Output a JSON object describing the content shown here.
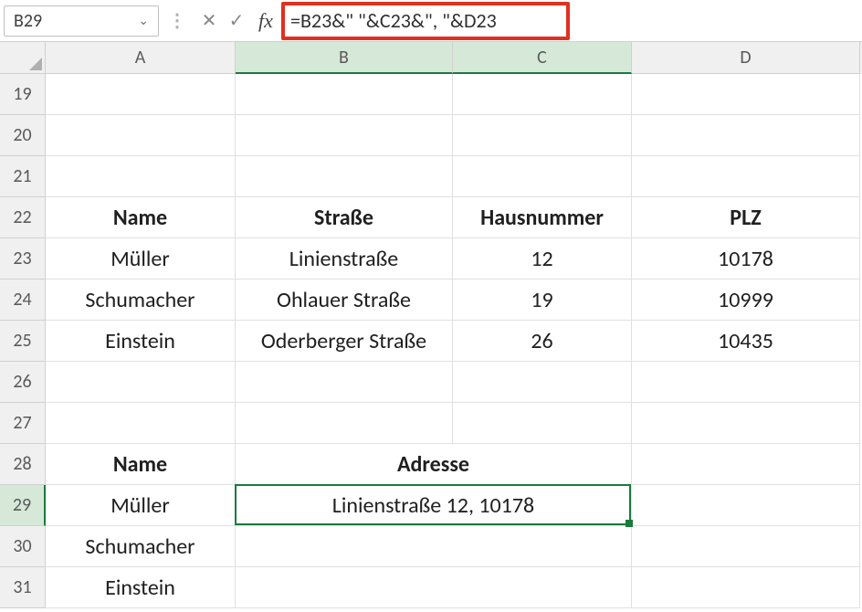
{
  "name_box": "B29",
  "formula": "=B23&\" \"&C23&\", \"&D23",
  "columns": [
    "A",
    "B",
    "C",
    "D"
  ],
  "rows": [
    "19",
    "20",
    "21",
    "22",
    "23",
    "24",
    "25",
    "26",
    "27",
    "28",
    "29",
    "30",
    "31"
  ],
  "header1": {
    "A": "Name",
    "B": "Straße",
    "C": "Hausnummer",
    "D": "PLZ"
  },
  "data1": [
    {
      "A": "Müller",
      "B": "Linienstraße",
      "C": "12",
      "D": "10178"
    },
    {
      "A": "Schumacher",
      "B": "Ohlauer Straße",
      "C": "19",
      "D": "10999"
    },
    {
      "A": "Einstein",
      "B": "Oderberger Straße",
      "C": "26",
      "D": "10435"
    }
  ],
  "header2": {
    "A": "Name",
    "BC": "Adresse"
  },
  "data2": [
    {
      "A": "Müller",
      "BC": "Linienstraße 12, 10178"
    },
    {
      "A": "Schumacher",
      "BC": ""
    },
    {
      "A": "Einstein",
      "BC": ""
    }
  ],
  "icons": {
    "cancel": "✕",
    "confirm": "✓",
    "fx": "fx",
    "chevron": "⌄",
    "sep": "⋮"
  }
}
